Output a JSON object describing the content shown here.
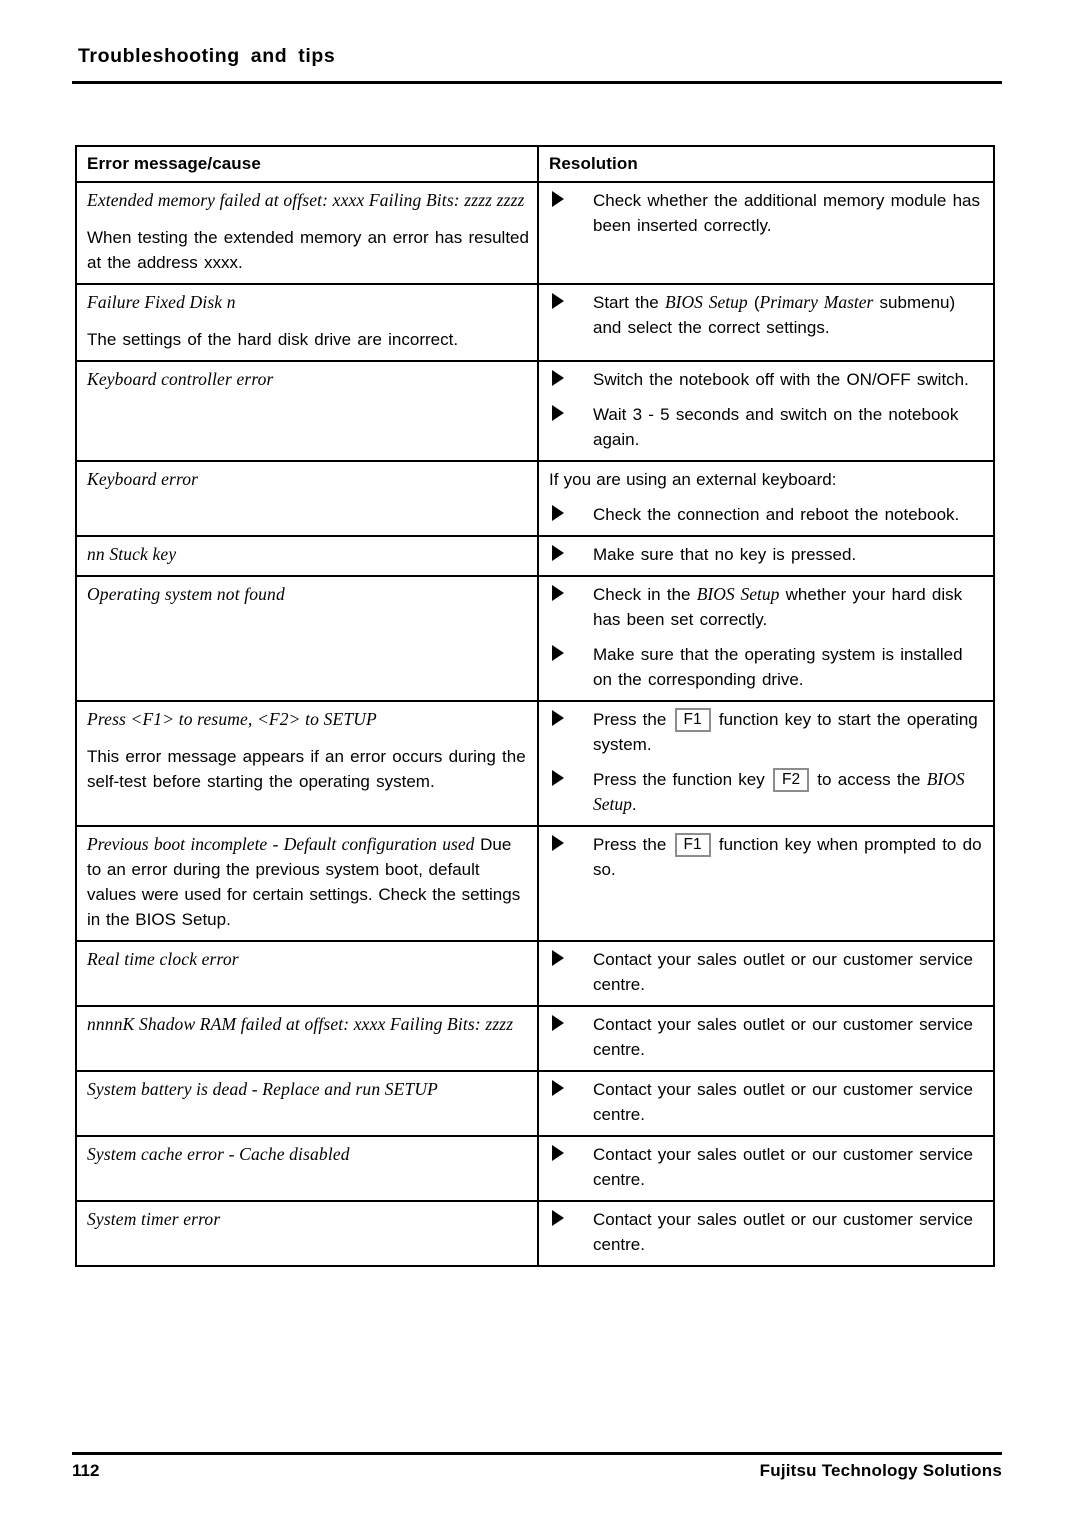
{
  "header": {
    "title": "Troubleshooting and tips"
  },
  "table": {
    "columns": {
      "error": "Error message/cause",
      "resolution": "Resolution"
    },
    "rows": [
      {
        "id": "extended-memory-failed",
        "message": "Extended memory failed at offset: xxxx Failing Bits: zzzz zzzz",
        "explanation": "When testing the extended memory an error has resulted at the address xxxx.",
        "steps": [
          "Check whether the additional memory module has been inserted correctly."
        ]
      },
      {
        "id": "failure-fixed-disk",
        "message": "Failure Fixed Disk n",
        "explanation": "The settings of the hard disk drive are incorrect.",
        "steps_rich": [
          {
            "parts": [
              {
                "text": "Start the ",
                "style": "regular"
              },
              {
                "text": "BIOS Setup",
                "style": "italic"
              },
              {
                "text": " (",
                "style": "regular"
              },
              {
                "text": "Primary Master",
                "style": "italic"
              },
              {
                "text": " submenu) and select the correct settings.",
                "style": "regular"
              }
            ]
          }
        ]
      },
      {
        "id": "keyboard-controller-error",
        "message": "Keyboard controller error",
        "steps": [
          "Switch the notebook off with the ON/OFF switch.",
          "Wait 3 - 5 seconds and switch on the notebook again."
        ]
      },
      {
        "id": "keyboard-error",
        "message": "Keyboard error",
        "lead_in": "If you are using an external keyboard:",
        "steps": [
          "Check the connection and reboot the notebook."
        ]
      },
      {
        "id": "stuck-key",
        "message": "nn Stuck key",
        "steps": [
          "Make sure that no key is pressed."
        ]
      },
      {
        "id": "operating-system-not-found",
        "message": "Operating system not found",
        "steps_rich": [
          {
            "parts": [
              {
                "text": "Check in the ",
                "style": "regular"
              },
              {
                "text": "BIOS Setup",
                "style": "italic"
              },
              {
                "text": " whether your hard disk has been set correctly.",
                "style": "regular"
              }
            ]
          },
          {
            "parts": [
              {
                "text": "Make sure that the operating system is installed on the corresponding drive.",
                "style": "regular"
              }
            ]
          }
        ]
      },
      {
        "id": "press-f1-to-resume",
        "message": "Press <F1> to resume, <F2> to SETUP",
        "explanation": "This error message appears if an error occurs during the self-test before starting the operating system.",
        "steps_rich": [
          {
            "parts": [
              {
                "text": "Press the ",
                "style": "regular"
              },
              {
                "text": "F1",
                "style": "keycap"
              },
              {
                "text": " function key to start the operating system.",
                "style": "regular"
              }
            ]
          },
          {
            "parts": [
              {
                "text": "Press the function key ",
                "style": "regular"
              },
              {
                "text": "F2",
                "style": "keycap"
              },
              {
                "text": " to access the ",
                "style": "regular"
              },
              {
                "text": "BIOS Setup",
                "style": "italic"
              },
              {
                "text": ".",
                "style": "regular"
              }
            ]
          }
        ]
      },
      {
        "id": "previous-boot-incomplete",
        "message_mixed": [
          {
            "text": "Previous boot incomplete - Default configuration used",
            "style": "italic"
          },
          {
            "text": " Due to an error during the previous system boot, default values were used for certain settings. Check the settings in the BIOS Setup.",
            "style": "regular"
          }
        ],
        "steps_rich": [
          {
            "parts": [
              {
                "text": "Press the ",
                "style": "regular"
              },
              {
                "text": "F1",
                "style": "keycap"
              },
              {
                "text": " function key when prompted to do so.",
                "style": "regular"
              }
            ]
          }
        ]
      },
      {
        "id": "real-time-clock-error",
        "message": "Real time clock error",
        "steps": [
          "Contact your sales outlet or our customer service centre."
        ]
      },
      {
        "id": "shadow-ram-failed",
        "message": "nnnnK Shadow RAM failed at offset: xxxx Failing Bits: zzzz",
        "steps": [
          "Contact your sales outlet or our customer service centre."
        ]
      },
      {
        "id": "system-battery-dead",
        "message": "System battery is dead - Replace and run SETUP",
        "steps": [
          "Contact your sales outlet or our customer service centre."
        ]
      },
      {
        "id": "system-cache-error",
        "message": "System cache error - Cache disabled",
        "steps": [
          "Contact your sales outlet or our customer service centre."
        ]
      },
      {
        "id": "system-timer-error",
        "message": "System timer error",
        "steps": [
          "Contact your sales outlet or our customer service centre."
        ]
      }
    ]
  },
  "footer": {
    "page_number": "112",
    "brand": "Fujitsu Technology Solutions"
  }
}
